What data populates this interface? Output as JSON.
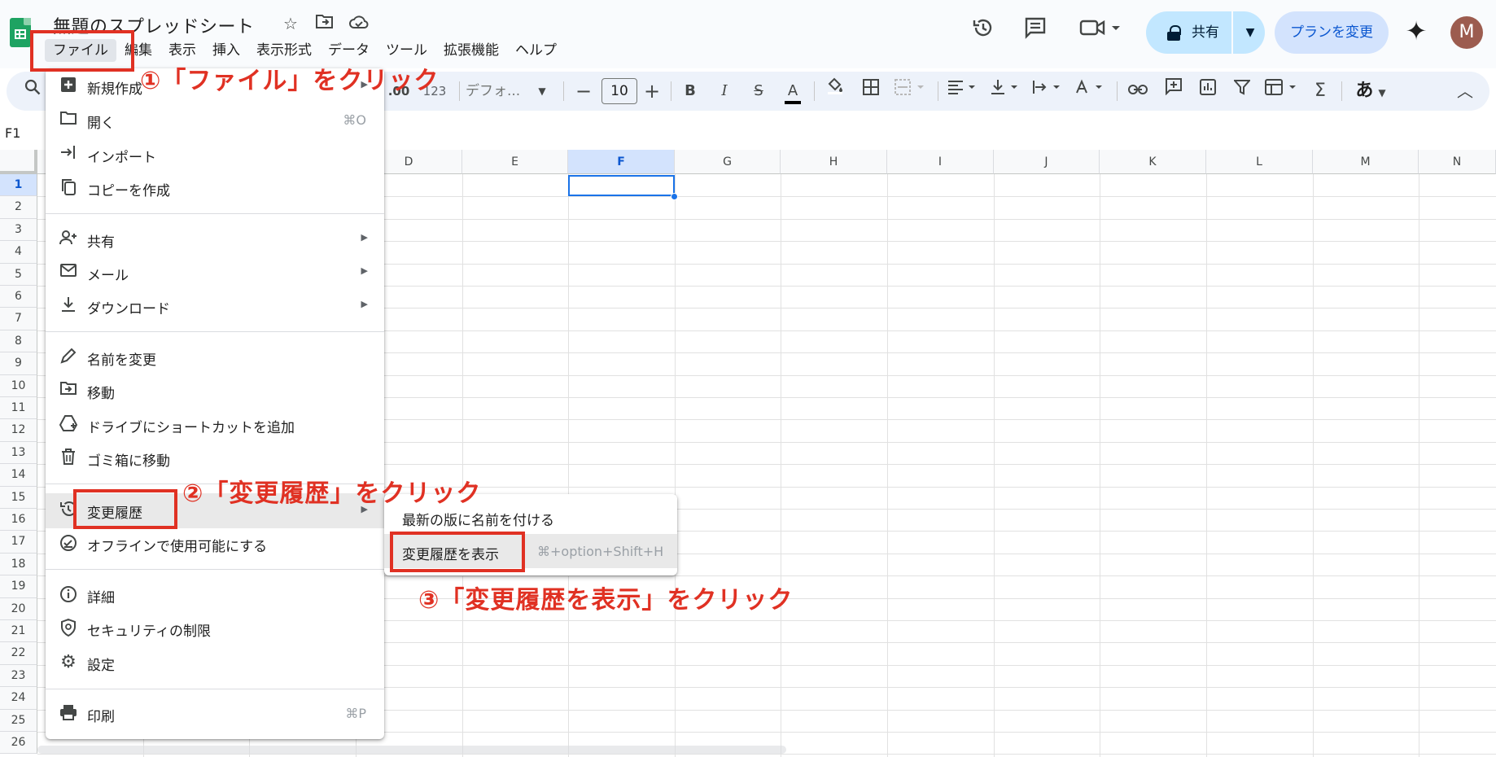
{
  "doc": {
    "title": "無題のスプレッドシート"
  },
  "menubar": [
    "ファイル",
    "編集",
    "表示",
    "挿入",
    "表示形式",
    "データ",
    "ツール",
    "拡張機能",
    "ヘルプ"
  ],
  "header": {
    "share_label": "共有",
    "plan_label": "プランを変更",
    "avatar_letter": "M"
  },
  "toolbar": {
    "decimal_more": ".00",
    "number_format": "123",
    "font_family": "デフォ...",
    "font_size": "10"
  },
  "formula_bar": {
    "name_box": "F1"
  },
  "grid": {
    "columns": [
      "D",
      "E",
      "F",
      "G",
      "H",
      "I",
      "J",
      "K",
      "L",
      "M",
      "N"
    ],
    "selected_column": "F",
    "rows": [
      "1",
      "2",
      "3",
      "4",
      "5",
      "6",
      "7",
      "8",
      "9",
      "10",
      "11",
      "12",
      "13",
      "14",
      "15",
      "16",
      "17",
      "18",
      "19",
      "20",
      "21",
      "22",
      "23",
      "24",
      "25",
      "26"
    ],
    "selected_cell": "F1"
  },
  "file_menu": {
    "items": [
      {
        "label": "新規作成",
        "icon": "plus-box-icon",
        "arrow": true
      },
      {
        "label": "開く",
        "icon": "folder-icon",
        "shortcut": "⌘O"
      },
      {
        "label": "インポート",
        "icon": "import-icon"
      },
      {
        "label": "コピーを作成",
        "icon": "copy-icon"
      },
      {
        "label": "共有",
        "icon": "person-add-icon",
        "arrow": true
      },
      {
        "label": "メール",
        "icon": "mail-icon",
        "arrow": true
      },
      {
        "label": "ダウンロード",
        "icon": "download-icon",
        "arrow": true
      },
      {
        "label": "名前を変更",
        "icon": "pencil-icon"
      },
      {
        "label": "移動",
        "icon": "folder-move-icon"
      },
      {
        "label": "ドライブにショートカットを追加",
        "icon": "drive-shortcut-icon"
      },
      {
        "label": "ゴミ箱に移動",
        "icon": "trash-icon"
      },
      {
        "label": "変更履歴",
        "icon": "history-icon",
        "arrow": true
      },
      {
        "label": "オフラインで使用可能にする",
        "icon": "offline-icon"
      },
      {
        "label": "詳細",
        "icon": "info-icon"
      },
      {
        "label": "セキュリティの制限",
        "icon": "shield-icon"
      },
      {
        "label": "設定",
        "icon": "gear-icon"
      },
      {
        "label": "印刷",
        "icon": "print-icon",
        "shortcut": "⌘P"
      }
    ]
  },
  "version_submenu": {
    "items": [
      {
        "label": "最新の版に名前を付ける"
      },
      {
        "label": "変更履歴を表示",
        "shortcut": "⌘+option+Shift+H"
      }
    ]
  },
  "annotations": {
    "step1": "①「ファイル」をクリック",
    "step2": "②「変更履歴」をクリック",
    "step3": "③「変更履歴を表示」をクリック",
    "color": "#e03123"
  },
  "colors": {
    "accent": "#1a73e8",
    "share_bg": "#c2e7ff",
    "sheets_green": "#1ea362"
  }
}
